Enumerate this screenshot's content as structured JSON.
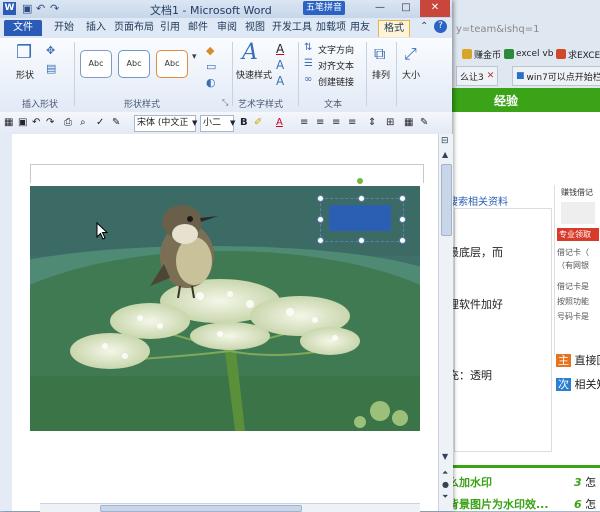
{
  "browser": {
    "url_text": "y=team&ishq=1",
    "bookmarks": [
      {
        "label": "赚金币",
        "color": "#d7a52a"
      },
      {
        "label": "excel vb",
        "color": "#2a8c3a"
      },
      {
        "label": "求EXCE",
        "color": "#d04a2a"
      }
    ],
    "tabs": [
      {
        "label": "么让3"
      },
      {
        "label": "win7可以点开始栏"
      }
    ],
    "header_label": "经验",
    "search_related": "搜索相关资料",
    "content_lines": [
      "最底层，而",
      "理软件加好",
      "充：透明"
    ],
    "actions": [
      {
        "icon": "主",
        "label": "直接回",
        "color": "#e8731e"
      },
      {
        "icon": "次",
        "label": "相关知",
        "color": "#2b7fd1"
      }
    ],
    "side": {
      "earn": "赚钱借记",
      "tag": "专业领取",
      "note1": "借记卡（",
      "note2": "（有网银",
      "note3": "借记卡是",
      "note4": "按照功能",
      "note5": "号码卡是"
    },
    "links": [
      {
        "text": "么加水印",
        "num": "3",
        "label": "怎"
      },
      {
        "text": "背景图片为水印效...",
        "num": "6",
        "label": "怎"
      }
    ]
  },
  "word": {
    "title": "文档1 - Microsoft Word",
    "ime": "五笔拼音",
    "window_buttons": [
      "—",
      "□",
      "✕"
    ],
    "ribbon_tabs": [
      "文件",
      "开始",
      "插入",
      "页面布局",
      "引用",
      "邮件",
      "审阅",
      "视图",
      "开发工具",
      "加载项",
      "用友",
      "格式"
    ],
    "active_tab": "格式",
    "ribbon": {
      "insert_shape": {
        "button": "形状",
        "group": "插入形状"
      },
      "shape_styles": {
        "samples": [
          "Abc",
          "Abc",
          "Abc"
        ],
        "group": "形状样式"
      },
      "wordart": {
        "button": "快速样式",
        "group": "艺术字样式"
      },
      "text": {
        "items": [
          "文字方向",
          "对齐文本",
          "创建链接"
        ],
        "group": "文本"
      },
      "arrange": {
        "button": "排列"
      },
      "size": {
        "button": "大小"
      }
    },
    "toolbar": {
      "font_name": "宋体 (中文正",
      "font_size": "小二",
      "bold": "B",
      "align_buttons": [
        "≡",
        "≡",
        "≡",
        "≡"
      ]
    },
    "colors": {
      "accent": "#2a5cb7",
      "textbox_fill": "#2b5fb4",
      "format_tab": "#e6b54a"
    }
  }
}
